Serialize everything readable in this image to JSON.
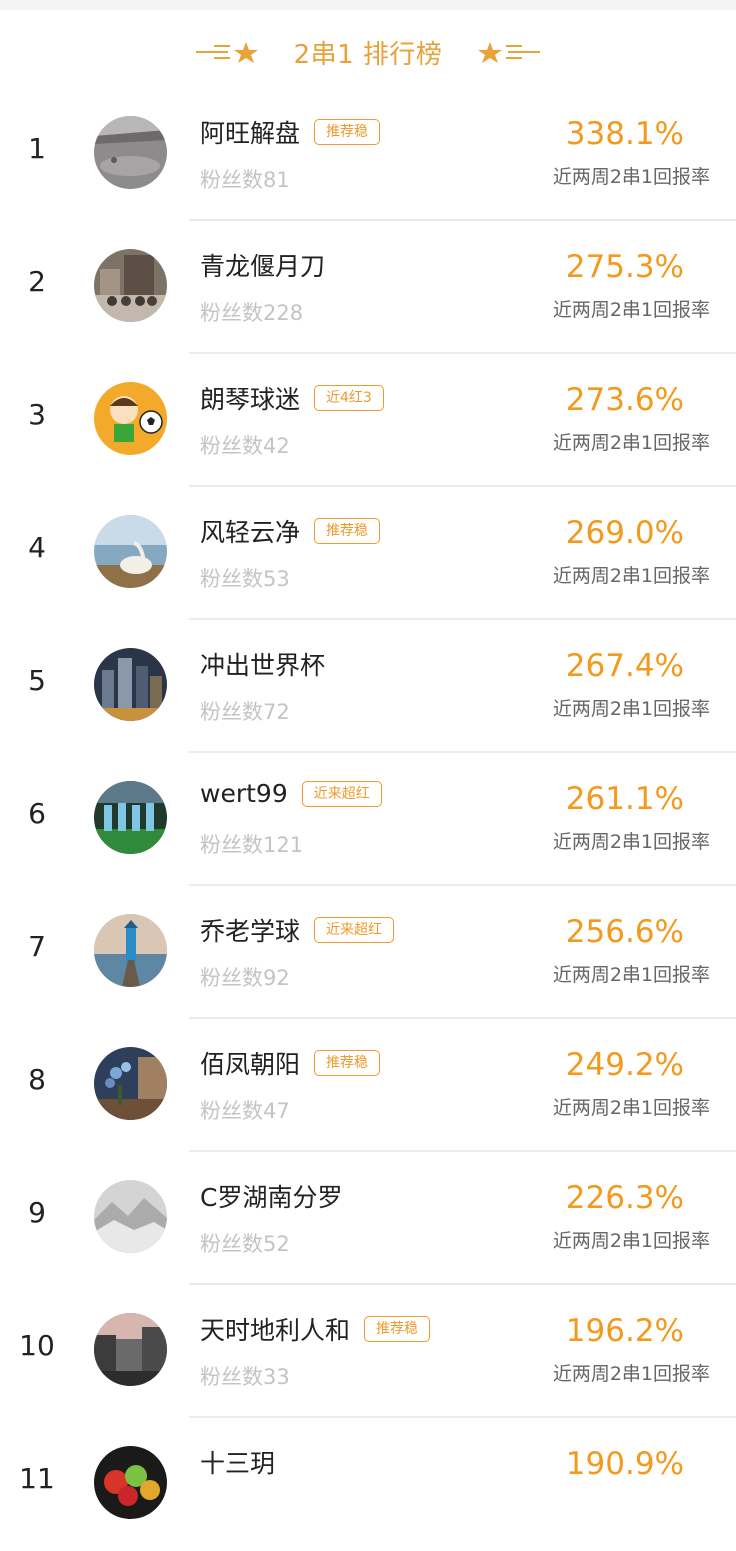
{
  "header": {
    "title": "2串1 排行榜",
    "accent_color": "#e8a23a"
  },
  "rate_label": "近两周2串1回报率",
  "rows": [
    {
      "rank": "1",
      "name": "阿旺解盘",
      "badge": "推荐稳",
      "fans": "粉丝数81",
      "rate": "338.1%",
      "rate_label": "近两周2串1回报率",
      "avatar": "harbor-photo"
    },
    {
      "rank": "2",
      "name": "青龙偃月刀",
      "badge": "",
      "fans": "粉丝数228",
      "rate": "275.3%",
      "rate_label": "近两周2串1回报率",
      "avatar": "group-photo"
    },
    {
      "rank": "3",
      "name": "朗琴球迷",
      "badge": "近4红3",
      "fans": "粉丝数42",
      "rate": "273.6%",
      "rate_label": "近两周2串1回报率",
      "avatar": "cartoon-soccer-boy"
    },
    {
      "rank": "4",
      "name": "风轻云净",
      "badge": "推荐稳",
      "fans": "粉丝数53",
      "rate": "269.0%",
      "rate_label": "近两周2串1回报率",
      "avatar": "swan-photo"
    },
    {
      "rank": "5",
      "name": "冲出世界杯",
      "badge": "",
      "fans": "粉丝数72",
      "rate": "267.4%",
      "rate_label": "近两周2串1回报率",
      "avatar": "city-night-photo"
    },
    {
      "rank": "6",
      "name": "wert99",
      "badge": "近来超红",
      "fans": "粉丝数121",
      "rate": "261.1%",
      "rate_label": "近两周2串1回报率",
      "avatar": "football-team-photo"
    },
    {
      "rank": "7",
      "name": "乔老学球",
      "badge": "近来超红",
      "fans": "粉丝数92",
      "rate": "256.6%",
      "rate_label": "近两周2串1回报率",
      "avatar": "lighthouse-photo"
    },
    {
      "rank": "8",
      "name": "佰凤朝阳",
      "badge": "推荐稳",
      "fans": "粉丝数47",
      "rate": "249.2%",
      "rate_label": "近两周2串1回报率",
      "avatar": "flowers-room-photo"
    },
    {
      "rank": "9",
      "name": "C罗湖南分罗",
      "badge": "",
      "fans": "粉丝数52",
      "rate": "226.3%",
      "rate_label": "近两周2串1回报率",
      "avatar": "snow-mountain-photo"
    },
    {
      "rank": "10",
      "name": "天时地利人和",
      "badge": "推荐稳",
      "fans": "粉丝数33",
      "rate": "196.2%",
      "rate_label": "近两周2串1回报率",
      "avatar": "sunset-street-photo"
    },
    {
      "rank": "11",
      "name": "十三玥",
      "badge": "",
      "fans": "",
      "rate": "190.9%",
      "rate_label": "",
      "avatar": "fruit-photo"
    }
  ]
}
